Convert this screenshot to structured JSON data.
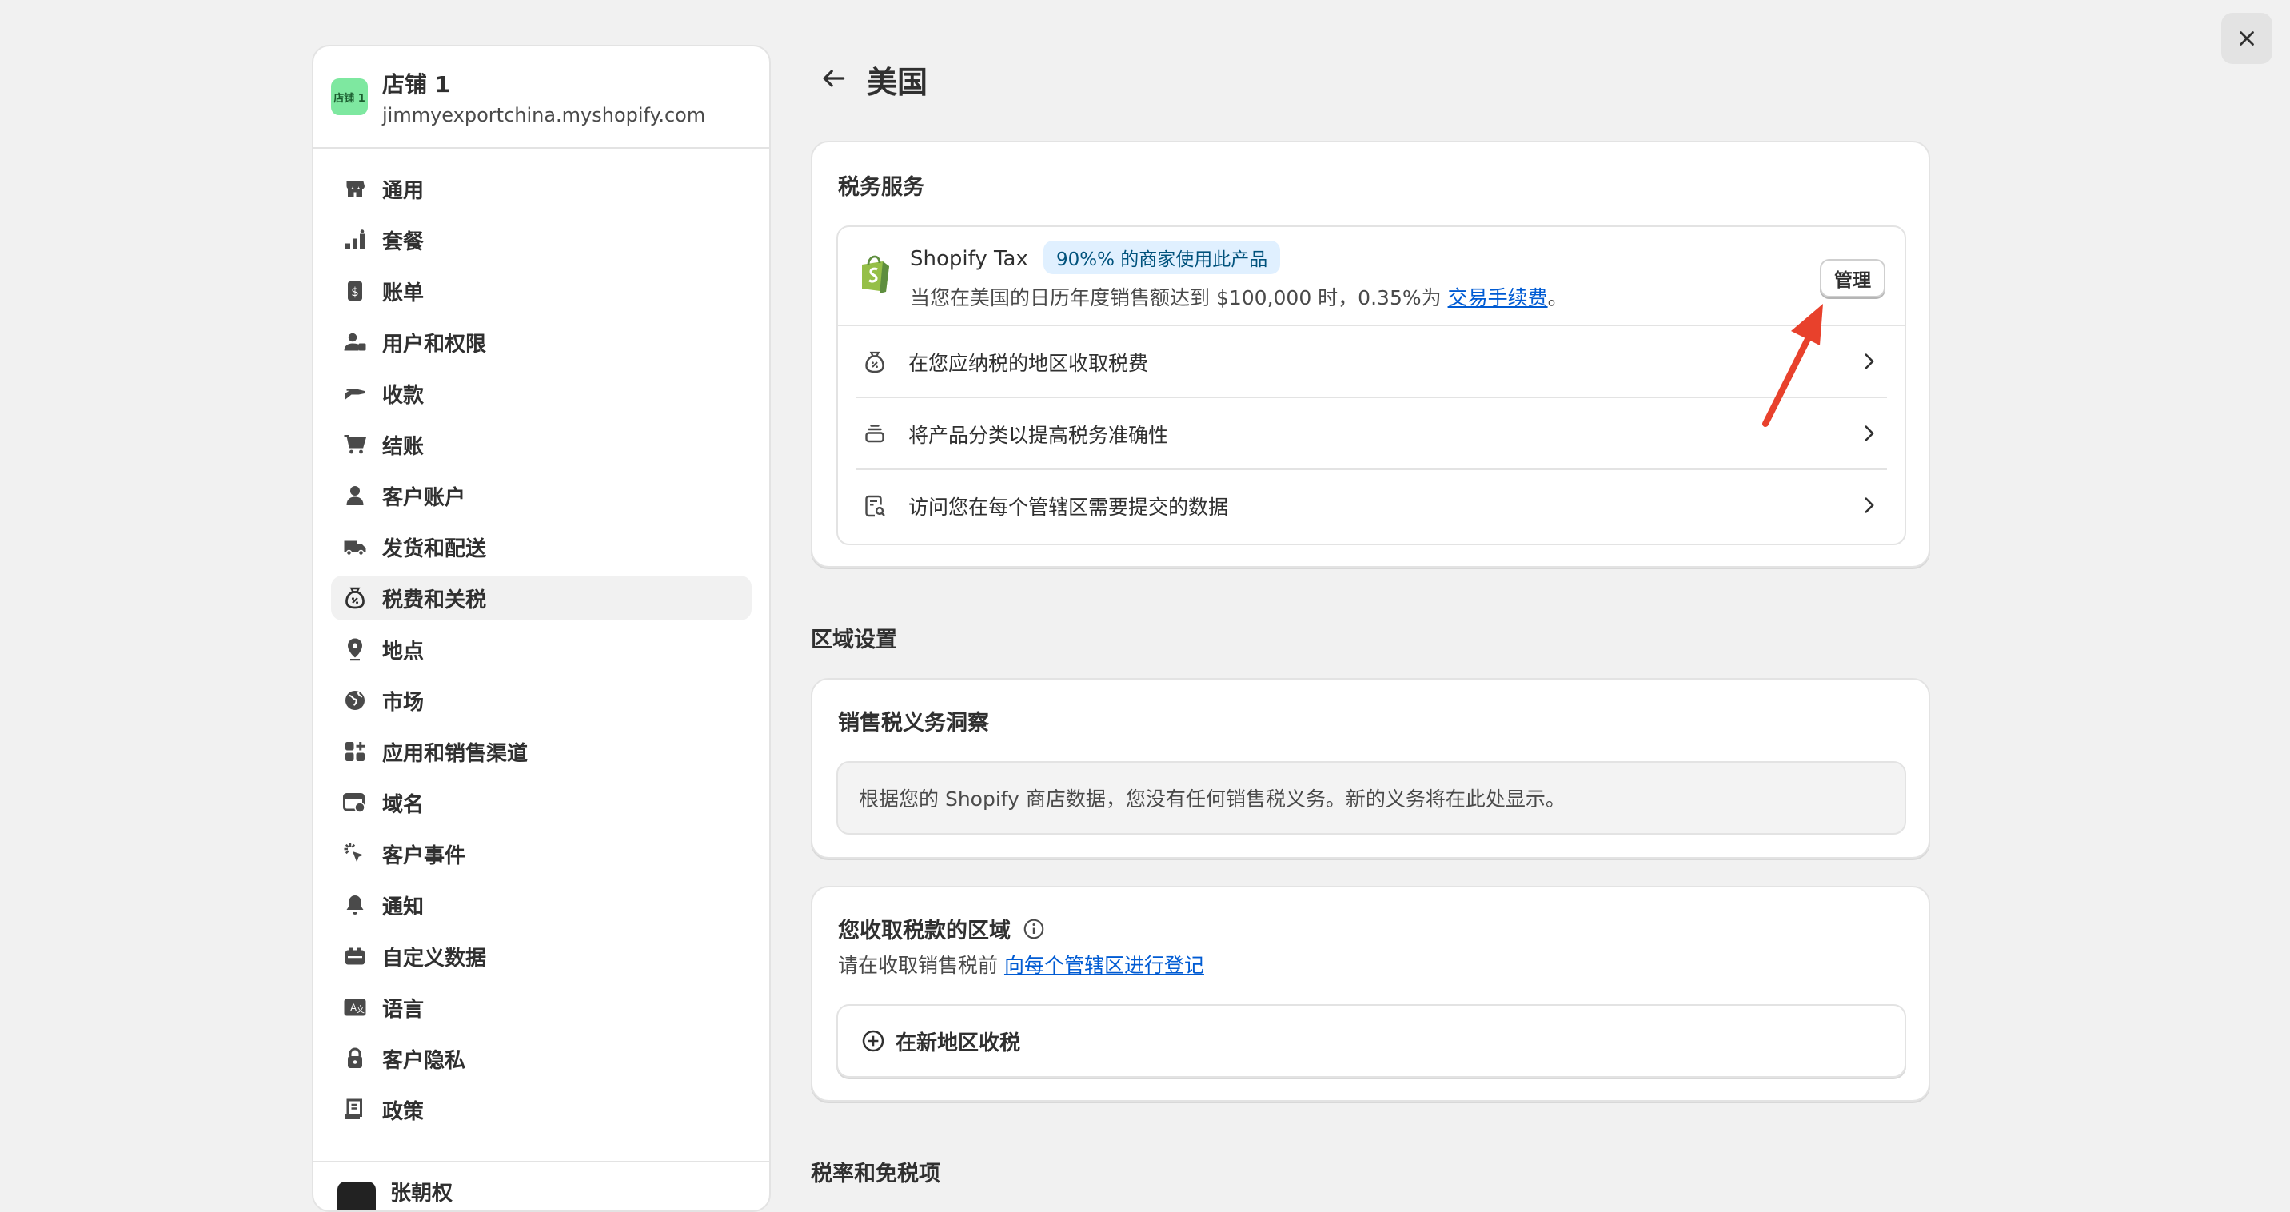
{
  "store": {
    "logo_text": "店铺 1",
    "name": "店铺 1",
    "url": "jimmyexportchina.myshopify.com"
  },
  "nav": {
    "items": [
      {
        "label": "通用",
        "icon": "store-icon"
      },
      {
        "label": "套餐",
        "icon": "plan-icon"
      },
      {
        "label": "账单",
        "icon": "billing-icon"
      },
      {
        "label": "用户和权限",
        "icon": "users-icon"
      },
      {
        "label": "收款",
        "icon": "payments-icon"
      },
      {
        "label": "结账",
        "icon": "cart-icon"
      },
      {
        "label": "客户账户",
        "icon": "person-icon"
      },
      {
        "label": "发货和配送",
        "icon": "truck-icon"
      },
      {
        "label": "税费和关税",
        "icon": "tax-bag-icon",
        "active": true
      },
      {
        "label": "地点",
        "icon": "location-icon"
      },
      {
        "label": "市场",
        "icon": "globe-icon"
      },
      {
        "label": "应用和销售渠道",
        "icon": "apps-icon"
      },
      {
        "label": "域名",
        "icon": "domain-icon"
      },
      {
        "label": "客户事件",
        "icon": "cursor-icon"
      },
      {
        "label": "通知",
        "icon": "bell-icon"
      },
      {
        "label": "自定义数据",
        "icon": "metafield-icon"
      },
      {
        "label": "语言",
        "icon": "language-icon"
      },
      {
        "label": "客户隐私",
        "icon": "lock-icon"
      },
      {
        "label": "政策",
        "icon": "policy-icon"
      }
    ]
  },
  "user": {
    "name": "张朝权"
  },
  "page": {
    "title": "美国"
  },
  "tax_services": {
    "title": "税务服务",
    "product_name": "Shopify Tax",
    "badge": "90%% 的商家使用此产品",
    "desc_prefix": "当您在美国的日历年度销售额达到 $100,000 时，0.35%为 ",
    "desc_link": "交易手续费",
    "desc_suffix": "。",
    "manage_label": "管理",
    "rows": [
      {
        "label": "在您应纳税的地区收取税费",
        "icon": "tax-bag-icon"
      },
      {
        "label": "将产品分类以提高税务准确性",
        "icon": "product-stack-icon"
      },
      {
        "label": "访问您在每个管辖区需要提交的数据",
        "icon": "report-search-icon"
      }
    ]
  },
  "regional": {
    "heading": "区域设置",
    "insight_title": "销售税义务洞察",
    "insight_text": "根据您的 Shopify 商店数据，您没有任何销售税义务。新的义务将在此处显示。",
    "collect_title": "您收取税款的区域",
    "collect_prefix": "请在收取销售税前 ",
    "collect_link": "向每个管辖区进行登记",
    "add_region_label": "在新地区收税"
  },
  "rates": {
    "heading": "税率和免税项"
  },
  "colors": {
    "accent_link": "#005bd3",
    "badge_bg": "#e0f0ff",
    "annotation_arrow": "#e8412c",
    "shopify_green": "#5e8e3e"
  }
}
